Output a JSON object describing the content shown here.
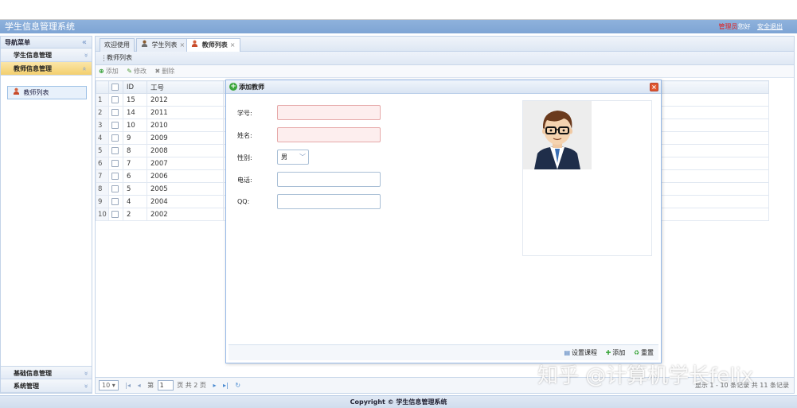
{
  "app": {
    "title": "学生信息管理系统",
    "user_name": "管理员",
    "greeting": "您好",
    "logout": "安全退出"
  },
  "sidebar": {
    "header": "导航菜单",
    "collapse_glyph": "«",
    "groups": [
      {
        "label": "学生信息管理",
        "glyph": "»"
      },
      {
        "label": "教师信息管理",
        "glyph": "»"
      }
    ],
    "active_item": "教师列表",
    "bottom_groups": [
      {
        "label": "基础信息管理",
        "glyph": "»"
      },
      {
        "label": "系统管理",
        "glyph": "»"
      }
    ]
  },
  "tabs": [
    {
      "label": "欢迎使用",
      "closable": false
    },
    {
      "label": "学生列表",
      "closable": true
    },
    {
      "label": "教师列表",
      "closable": true,
      "active": true
    }
  ],
  "tab_close_glyph": "×",
  "panel": {
    "title": "教师列表"
  },
  "toolbar": {
    "add": "添加",
    "edit": "修改",
    "delete": "删除"
  },
  "grid": {
    "columns": [
      "ID",
      "工号"
    ],
    "rows": [
      {
        "n": "1",
        "id": "15",
        "gh": "2012"
      },
      {
        "n": "2",
        "id": "14",
        "gh": "2011"
      },
      {
        "n": "3",
        "id": "10",
        "gh": "2010"
      },
      {
        "n": "4",
        "id": "9",
        "gh": "2009"
      },
      {
        "n": "5",
        "id": "8",
        "gh": "2008"
      },
      {
        "n": "6",
        "id": "7",
        "gh": "2007"
      },
      {
        "n": "7",
        "id": "6",
        "gh": "2006"
      },
      {
        "n": "8",
        "id": "5",
        "gh": "2005"
      },
      {
        "n": "9",
        "id": "4",
        "gh": "2004"
      },
      {
        "n": "10",
        "id": "2",
        "gh": "2002"
      }
    ]
  },
  "pager": {
    "page_size": "10",
    "page_prefix": "第",
    "page_value": "1",
    "page_suffix": "页 共 2 页",
    "info": "显示 1 - 10 条记录 共 11 条记录"
  },
  "dialog": {
    "title": "添加教师",
    "close_glyph": "×",
    "fields": {
      "number_label": "学号:",
      "name_label": "姓名:",
      "gender_label": "性别:",
      "gender_value": "男",
      "phone_label": "电话:",
      "qq_label": "QQ:"
    },
    "footer": {
      "set_course": "设置课程",
      "add": "添加",
      "reset": "重置"
    }
  },
  "footer": {
    "copyright": "Copyright © 学生信息管理系统"
  },
  "watermark": "知乎 @计算机学长felix",
  "colors": {
    "header_blue": "#7ea4d4",
    "required_bg": "#fdeeee",
    "active_group": "#f3cf6e",
    "close_red": "#e1572f"
  }
}
